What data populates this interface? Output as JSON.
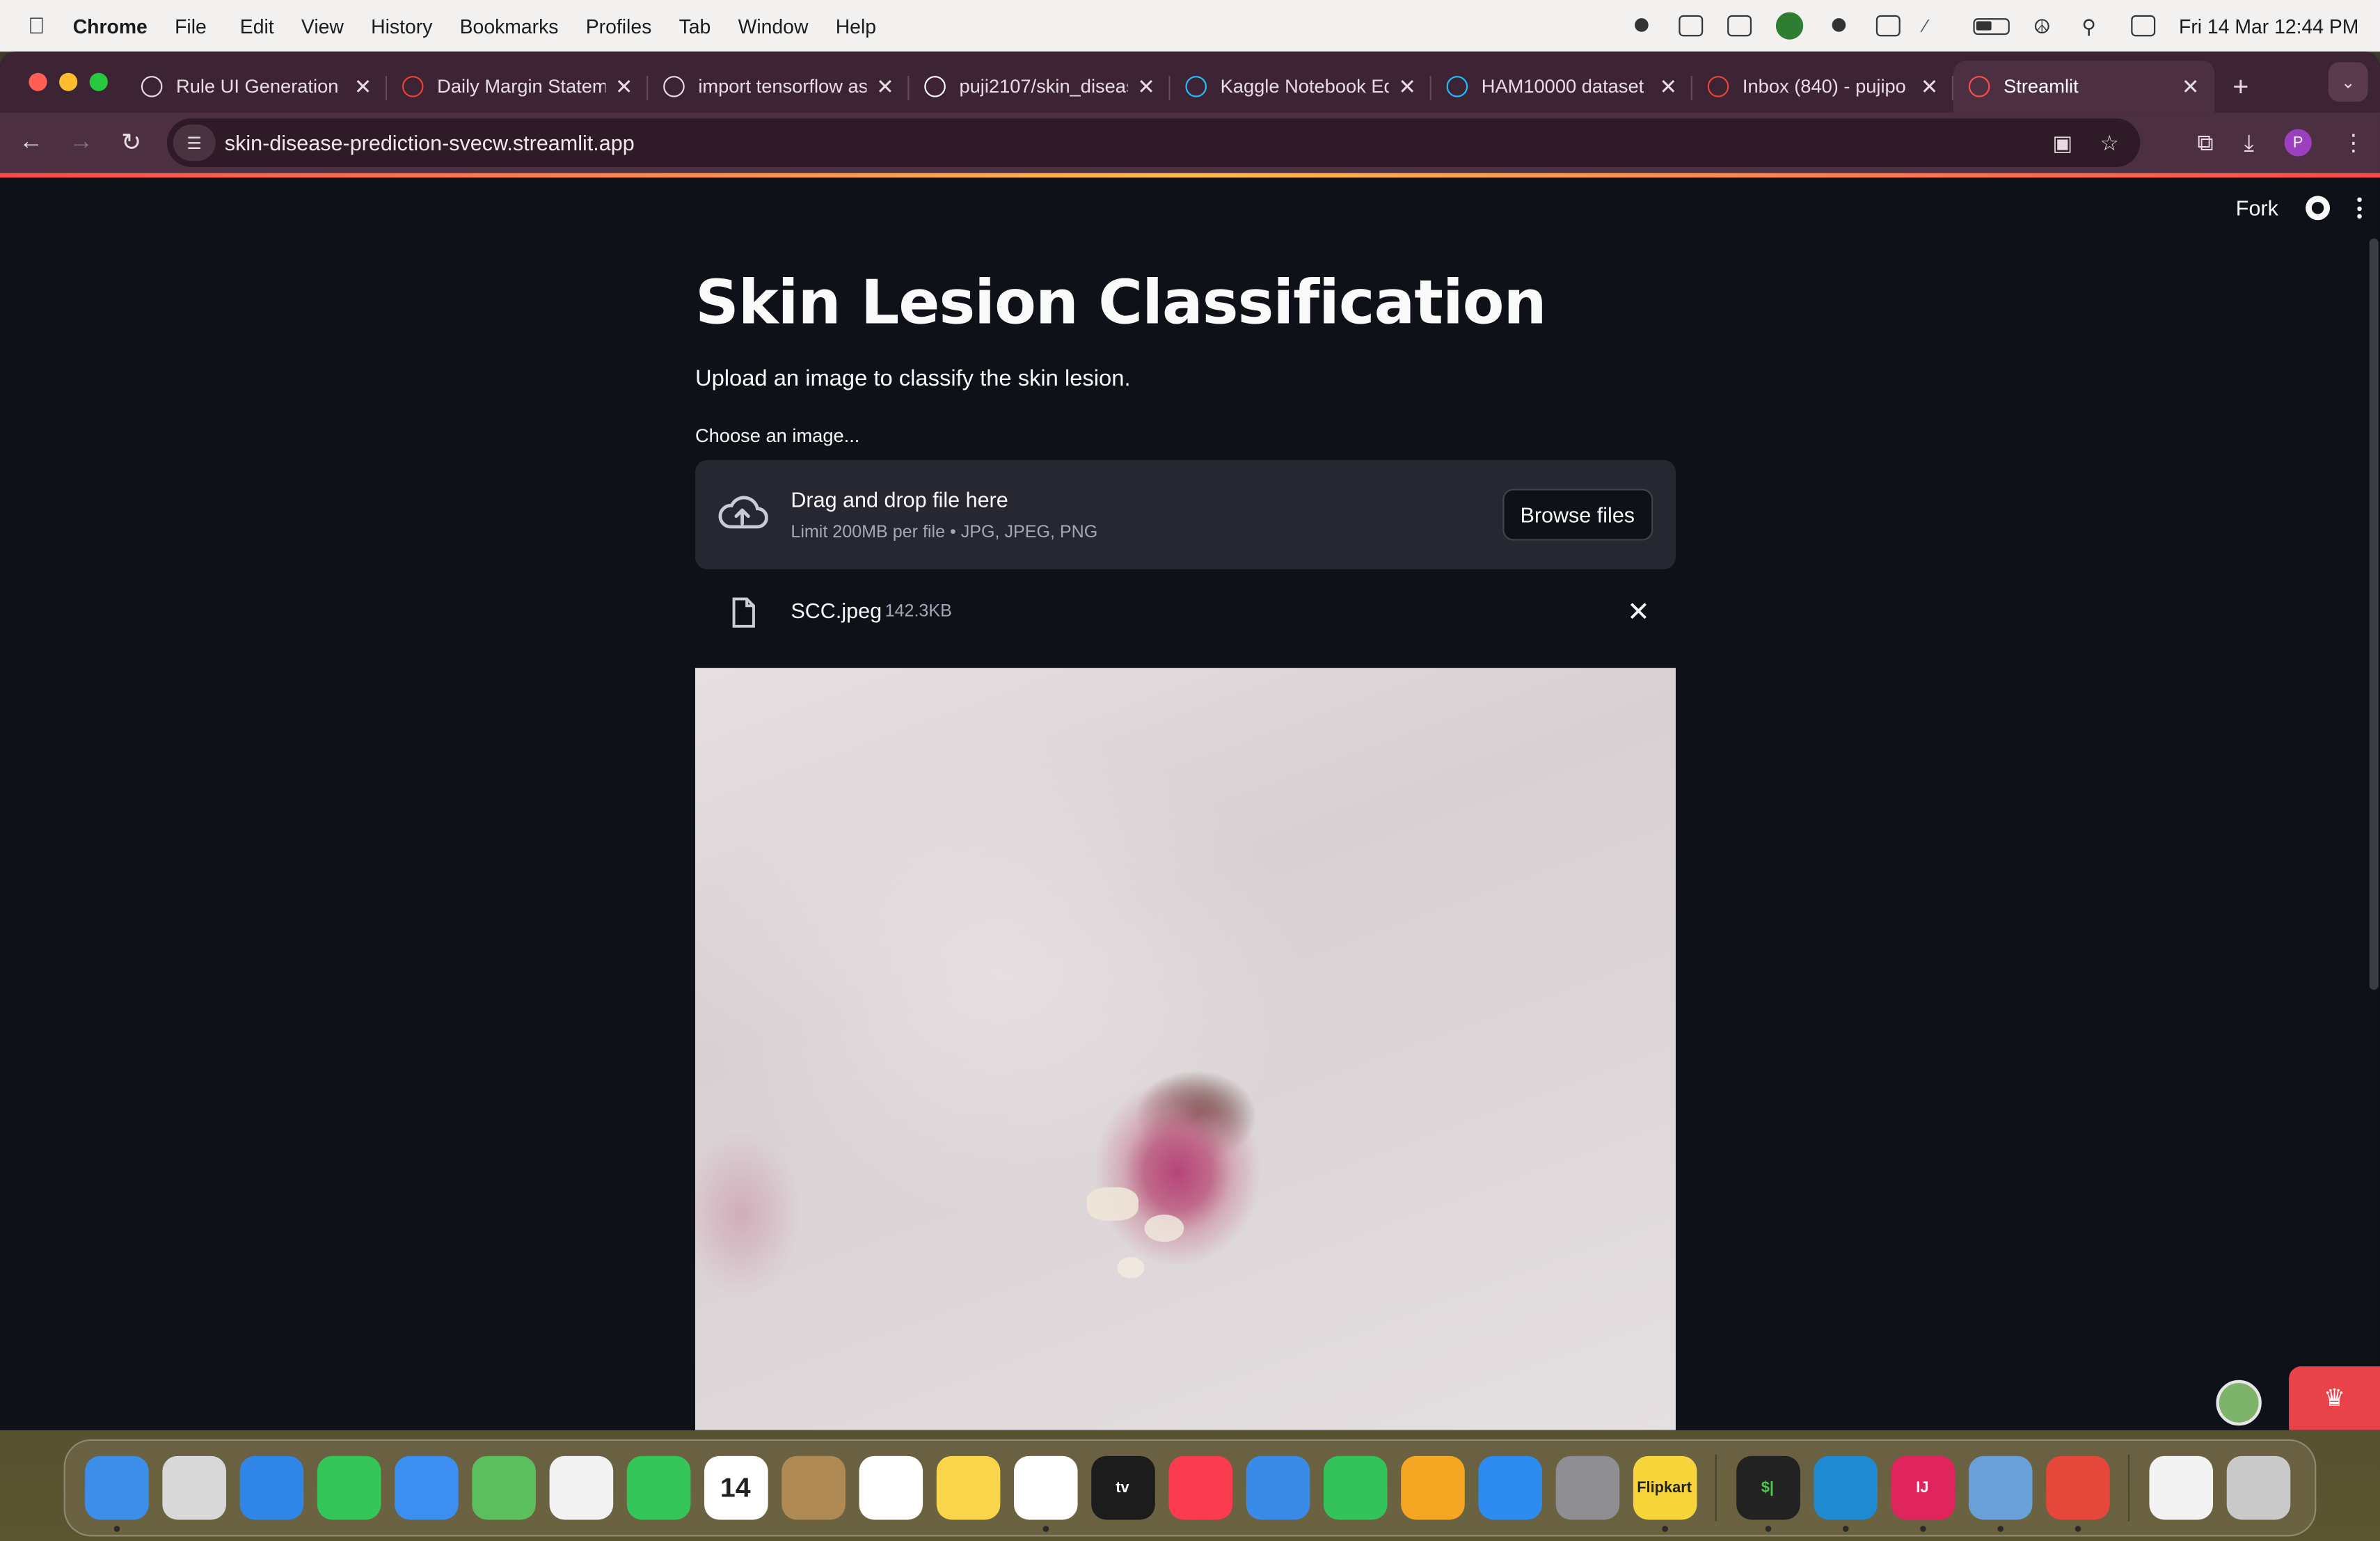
{
  "menubar": {
    "app_name": "Chrome",
    "items": [
      "File",
      "Edit",
      "View",
      "History",
      "Bookmarks",
      "Profiles",
      "Tab",
      "Window",
      "Help"
    ],
    "clock": "Fri 14 Mar  12:44 PM"
  },
  "tabs": [
    {
      "label": "Rule UI Generation",
      "icon": "openai-icon",
      "color": "#e8dde3"
    },
    {
      "label": "Daily Margin Statem",
      "icon": "gmail-icon",
      "color": "#ea4335"
    },
    {
      "label": "import tensorflow as",
      "icon": "openai-icon",
      "color": "#e8dde3"
    },
    {
      "label": "puji2107/skin_diseas",
      "icon": "github-icon",
      "color": "#ffffff"
    },
    {
      "label": "Kaggle Notebook Ed",
      "icon": "kaggle-icon",
      "color": "#20beff"
    },
    {
      "label": "HAM10000 dataset",
      "icon": "kaggle-icon",
      "color": "#20beff"
    },
    {
      "label": "Inbox (840) - pujipo",
      "icon": "gmail-icon",
      "color": "#ea4335"
    },
    {
      "label": "Streamlit",
      "icon": "streamlit-icon",
      "color": "#ff4b4b",
      "active": true
    }
  ],
  "toolbar": {
    "url": "skin-disease-prediction-svecw.streamlit.app",
    "profile_initial": "P"
  },
  "app": {
    "fork_label": "Fork",
    "title": "Skin Lesion Classification",
    "subtitle": "Upload an image to classify the skin lesion.",
    "uploader": {
      "label": "Choose an image...",
      "drop_title": "Drag and drop file here",
      "drop_sub": "Limit 200MB per file • JPG, JPEG, PNG",
      "browse_label": "Browse files"
    },
    "uploaded_file": {
      "name": "SCC.jpeg",
      "size": "142.3KB"
    }
  },
  "dock": {
    "apps": [
      {
        "name": "finder",
        "color": "#3d8ee8",
        "label": ""
      },
      {
        "name": "launchpad",
        "color": "#d8d8d8",
        "label": ""
      },
      {
        "name": "safari",
        "color": "#2f86e6",
        "label": ""
      },
      {
        "name": "messages",
        "color": "#35c659",
        "label": ""
      },
      {
        "name": "mail",
        "color": "#3c8ef0",
        "label": ""
      },
      {
        "name": "maps",
        "color": "#5bbf5e",
        "label": ""
      },
      {
        "name": "photos",
        "color": "#f2f2f2",
        "label": ""
      },
      {
        "name": "facetime",
        "color": "#35c659",
        "label": ""
      },
      {
        "name": "calendar",
        "color": "#ffffff",
        "label": "14"
      },
      {
        "name": "contacts",
        "color": "#b08a55",
        "label": ""
      },
      {
        "name": "reminders",
        "color": "#ffffff",
        "label": ""
      },
      {
        "name": "notes",
        "color": "#f8d54a",
        "label": ""
      },
      {
        "name": "freeform",
        "color": "#ffffff",
        "label": ""
      },
      {
        "name": "tv",
        "color": "#1c1c1c",
        "label": "tv"
      },
      {
        "name": "music",
        "color": "#fb3c50",
        "label": ""
      },
      {
        "name": "keynote",
        "color": "#3a8be8",
        "label": ""
      },
      {
        "name": "numbers",
        "color": "#34c25a",
        "label": ""
      },
      {
        "name": "pages",
        "color": "#f5a623",
        "label": ""
      },
      {
        "name": "app-store",
        "color": "#2e8cf0",
        "label": ""
      },
      {
        "name": "system-settings",
        "color": "#8e8e93",
        "label": ""
      },
      {
        "name": "flipkart",
        "color": "#f7d53a",
        "label": "Flipkart"
      },
      {
        "name": "terminal",
        "color": "#222222",
        "label": "$|"
      },
      {
        "name": "vscode",
        "color": "#1f8ad2",
        "label": ""
      },
      {
        "name": "intellij",
        "color": "#e0245e",
        "label": "IJ"
      },
      {
        "name": "preview",
        "color": "#6aa0d8",
        "label": ""
      },
      {
        "name": "chrome",
        "color": "#e5473b",
        "label": ""
      },
      {
        "name": "document",
        "color": "#f3f3f3",
        "label": ""
      },
      {
        "name": "trash",
        "color": "#c9c9c9",
        "label": ""
      }
    ]
  }
}
